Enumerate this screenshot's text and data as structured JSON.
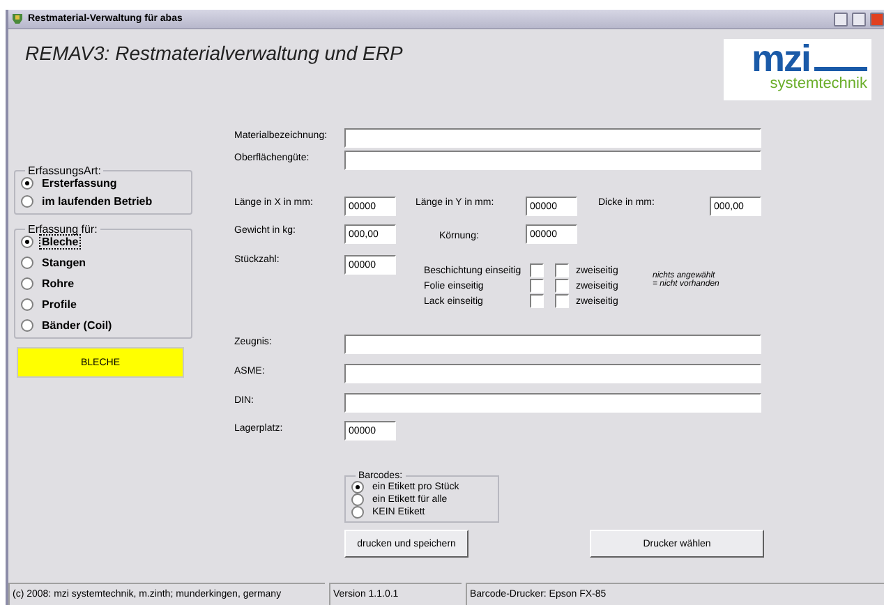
{
  "window": {
    "title": "Restmaterial-Verwaltung für abas"
  },
  "header": {
    "title": "REMAV3: Restmaterialverwaltung und ERP",
    "logo_name": "mzi",
    "logo_tagline": "systemtechnik"
  },
  "erfassungsart": {
    "label": "ErfassungsArt:",
    "options": [
      {
        "label": "Ersterfassung",
        "selected": true
      },
      {
        "label": "im laufenden Betrieb",
        "selected": false
      }
    ]
  },
  "erfassung_fuer": {
    "label": "Erfassung für:",
    "options": [
      {
        "label": "Bleche",
        "selected": true,
        "focused": true
      },
      {
        "label": "Stangen",
        "selected": false,
        "focused": false
      },
      {
        "label": "Rohre",
        "selected": false,
        "focused": false
      },
      {
        "label": "Profile",
        "selected": false,
        "focused": false
      },
      {
        "label": "Bänder (Coil)",
        "selected": false,
        "focused": false
      }
    ]
  },
  "category_button": "BLECHE",
  "material_fields": [
    {
      "label": "Materialbezeichnung:"
    },
    {
      "label": "Oberflächengüte:"
    }
  ],
  "measurements": [
    {
      "label": "Länge in X in mm:",
      "value": "00000"
    },
    {
      "label": "Länge in Y in mm:",
      "value": "00000"
    },
    {
      "label": "Dicke in mm:",
      "value": "000,00"
    },
    {
      "label": "Gewicht in kg:",
      "value": "000,00"
    },
    {
      "label": "Körnung:",
      "value": "00000"
    },
    {
      "label": "Stückzahl:",
      "value": "00000"
    }
  ],
  "coatings": [
    {
      "label": "Beschichtung einseitig",
      "one_sided": false,
      "two_sided_label": "zweiseitig",
      "two_sided": false
    },
    {
      "label": "Folie einseitig",
      "one_sided": false,
      "two_sided_label": "zweiseitig",
      "two_sided": false
    },
    {
      "label": "Lack einseitig",
      "one_sided": false,
      "two_sided_label": "zweiseitig",
      "two_sided": false
    }
  ],
  "coating_note": [
    "nichts angewählt",
    "= nicht vorhanden"
  ],
  "certificate_fields": [
    {
      "label": "Zeugnis:"
    },
    {
      "label": "ASME:"
    },
    {
      "label": "DIN:"
    }
  ],
  "storage": {
    "label": "Lagerplatz:",
    "value": "00000"
  },
  "barcodes": {
    "label": "Barcodes:",
    "options": [
      {
        "label": "ein Etikett pro Stück",
        "selected": true
      },
      {
        "label": "ein Etikett für alle",
        "selected": false
      },
      {
        "label": "KEIN Etikett",
        "selected": false
      }
    ]
  },
  "buttons": [
    "drucken und speichern",
    "Drucker wählen"
  ],
  "status_bar": [
    "(c) 2008: mzi systemtechnik, m.zinth; munderkingen, germany",
    "Version 1.1.0.1",
    "Barcode-Drucker: Epson FX-85"
  ]
}
